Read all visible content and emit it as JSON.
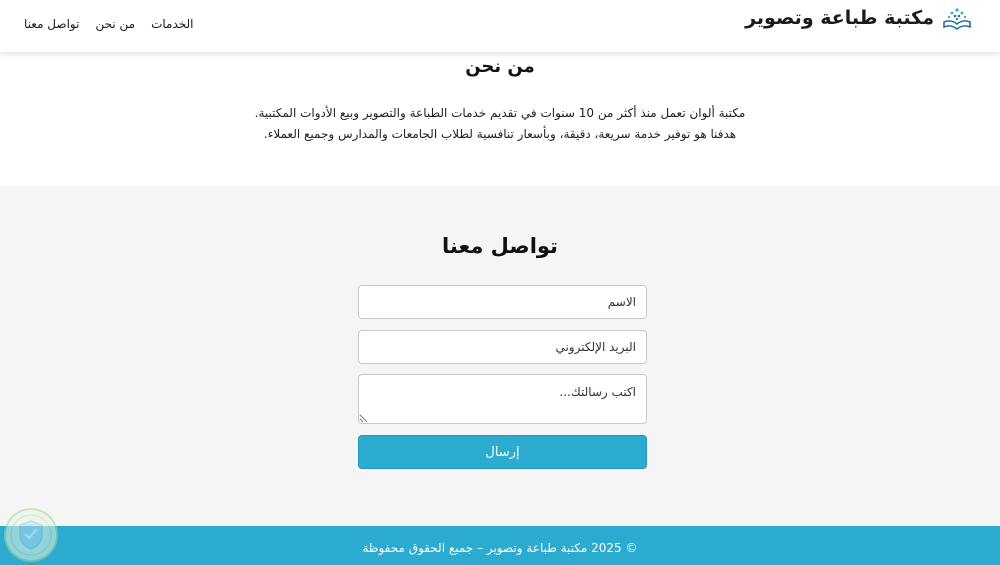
{
  "header": {
    "brand_title": "مكتبة طباعة وتصوير",
    "nav": [
      "الخدمات",
      "من نحن",
      "تواصل معنا"
    ]
  },
  "about": {
    "title": "من نحن",
    "text": "مكتبة ألوان تعمل منذ أكثر من 10 سنوات في تقديم خدمات الطباعة والتصوير وبيع الأدوات المكتبية. هدفنا هو توفير خدمة سريعة، دقيقة، وبأسعار تنافسية لطلاب الجامعات والمدارس وجميع العملاء."
  },
  "contact": {
    "title": "تواصل معنا",
    "name_placeholder": "الاسم",
    "email_placeholder": "البريد الإلكتروني",
    "message_placeholder": "اكتب رسالتك...",
    "submit_label": "إرسال"
  },
  "footer": {
    "text": "© 2025 مكتبة طباعة وتصوير – جميع الحقوق محفوظة"
  },
  "colors": {
    "accent": "#2aabcf",
    "section_bg": "#f5f5f5"
  },
  "icons": {
    "logo": "book-icon",
    "watermark": "shield-icon"
  }
}
